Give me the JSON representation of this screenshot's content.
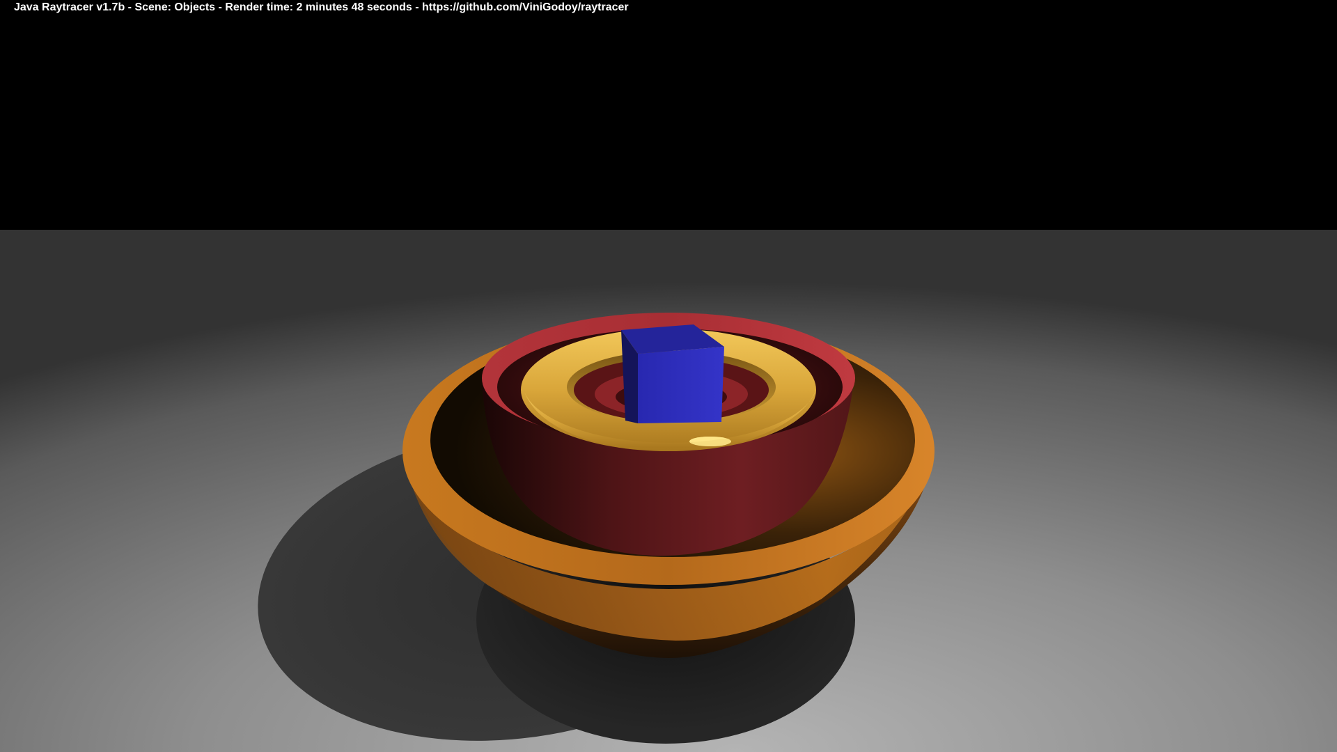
{
  "window": {
    "title": "Java Raytracer v1.7b - Scene: Objects - Render time: 2 minutes 48 seconds - https://github.com/ViniGodoy/raytracer"
  },
  "scene": {
    "name": "Objects",
    "objects": [
      {
        "name": "floor-plane",
        "color": "#9a9a9a"
      },
      {
        "name": "orange-bowl",
        "color": "#c8741e"
      },
      {
        "name": "red-bowl",
        "color": "#b3343a"
      },
      {
        "name": "gold-torus",
        "color": "#d9a83a"
      },
      {
        "name": "blue-cube",
        "color": "#2a2ab8"
      }
    ],
    "background_color": "#000000"
  }
}
